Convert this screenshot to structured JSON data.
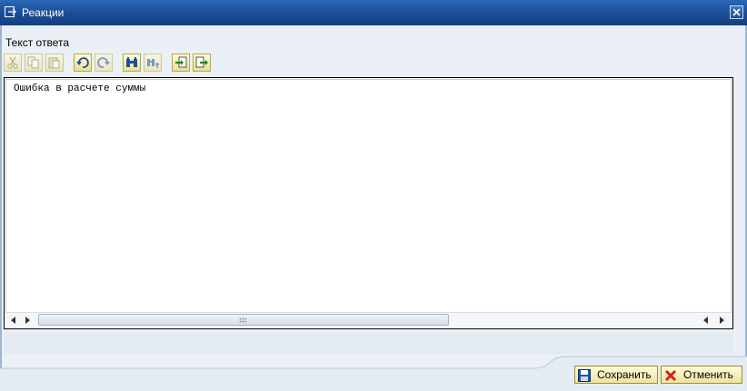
{
  "window": {
    "title": "Реакции"
  },
  "editor_label": "Текст ответа",
  "toolbar": {
    "buttons": [
      {
        "name": "cut-icon",
        "enabled": false
      },
      {
        "name": "copy-icon",
        "enabled": false
      },
      {
        "name": "paste-icon",
        "enabled": false
      },
      {
        "name": "undo-icon",
        "enabled": true
      },
      {
        "name": "redo-icon",
        "enabled": false
      },
      {
        "name": "find-icon",
        "enabled": true
      },
      {
        "name": "find-next-icon",
        "enabled": false
      },
      {
        "name": "load-file-icon",
        "enabled": true
      },
      {
        "name": "save-file-icon",
        "enabled": true
      }
    ]
  },
  "editor": {
    "text": "Ошибка в расчете суммы"
  },
  "scrollbar": {
    "thumb_fraction": 0.57
  },
  "footer": {
    "save_label": "Сохранить",
    "cancel_label": "Отменить"
  },
  "colors": {
    "title_bar": "#1a4c95",
    "button_face": "#fffbd8",
    "dialog_bg": "#eaf0f6"
  }
}
